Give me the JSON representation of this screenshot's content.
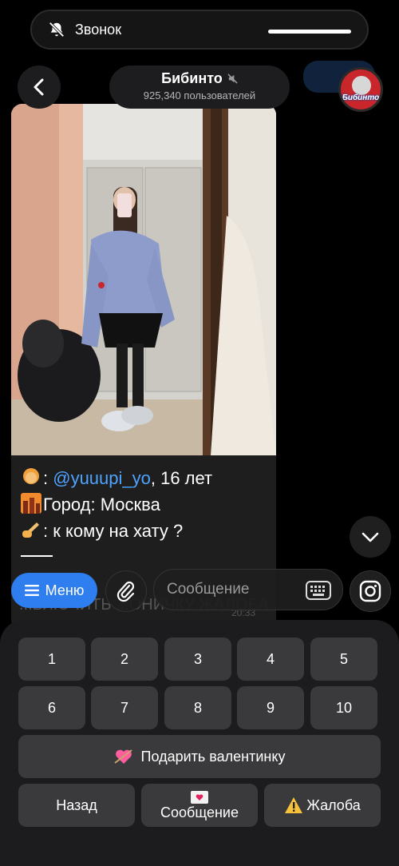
{
  "call": {
    "label": "Звонок"
  },
  "header": {
    "title": "Бибинто",
    "subtitle": "925,340 пользователей",
    "avatar_text": "Бибинто"
  },
  "message": {
    "mention": "@yuuupi_yo",
    "age": ", 16 лет",
    "city": "Город: Москва",
    "note": ": к кому на хату ?",
    "faded_text": "...ВЛЮЧИТЬ ...ОНИЧКУ ЖАЛОБА",
    "faded_time": "20:33"
  },
  "input": {
    "menu_label": "Меню",
    "placeholder": "Сообщение"
  },
  "keyboard": {
    "row1": [
      "1",
      "2",
      "3",
      "4",
      "5"
    ],
    "row2": [
      "6",
      "7",
      "8",
      "9",
      "10"
    ],
    "valentine_label": "Подарить валентинку",
    "back_label": "Назад",
    "message_label": "Сообщение",
    "complaint_label": "Жалоба"
  },
  "colors": {
    "accent": "#2f7ef0",
    "mention": "#4ea3ff",
    "button": "#3a3a3c",
    "keyboard_bg": "#1c1c1e"
  },
  "icons": [
    "bell-off-icon",
    "back-arrow-icon",
    "mute-icon",
    "chevron-down-icon",
    "menu-icon",
    "paperclip-icon",
    "keyboard-icon",
    "instagram-icon",
    "heart-arrow-icon",
    "love-letter-icon",
    "warning-icon"
  ]
}
